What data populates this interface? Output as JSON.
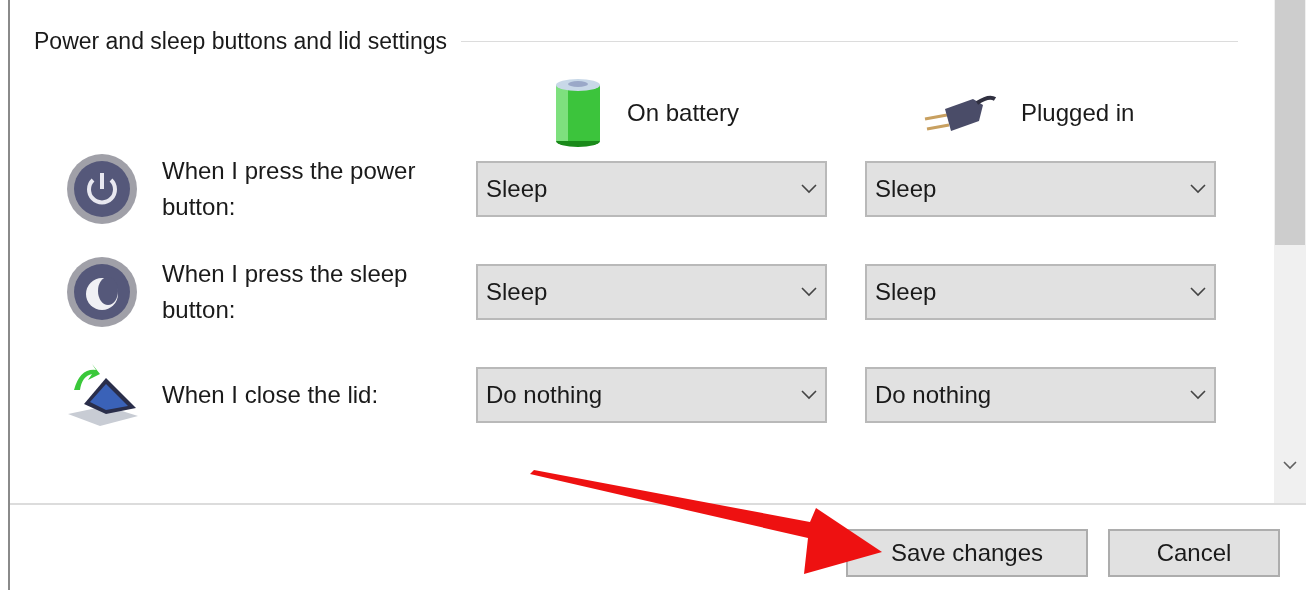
{
  "group_title": "Power and sleep buttons and lid settings",
  "columns": [
    {
      "kind": "battery",
      "label": "On battery"
    },
    {
      "kind": "plug",
      "label": "Plugged in"
    }
  ],
  "rows": [
    {
      "kind": "power",
      "label": "When I press the power button:",
      "values": [
        "Sleep",
        "Sleep"
      ]
    },
    {
      "kind": "sleep",
      "label": "When I press the sleep button:",
      "values": [
        "Sleep",
        "Sleep"
      ]
    },
    {
      "kind": "lid",
      "label": "When I close the lid:",
      "values": [
        "Do nothing",
        "Do nothing"
      ]
    }
  ],
  "buttons": [
    "Save changes",
    "Cancel"
  ]
}
